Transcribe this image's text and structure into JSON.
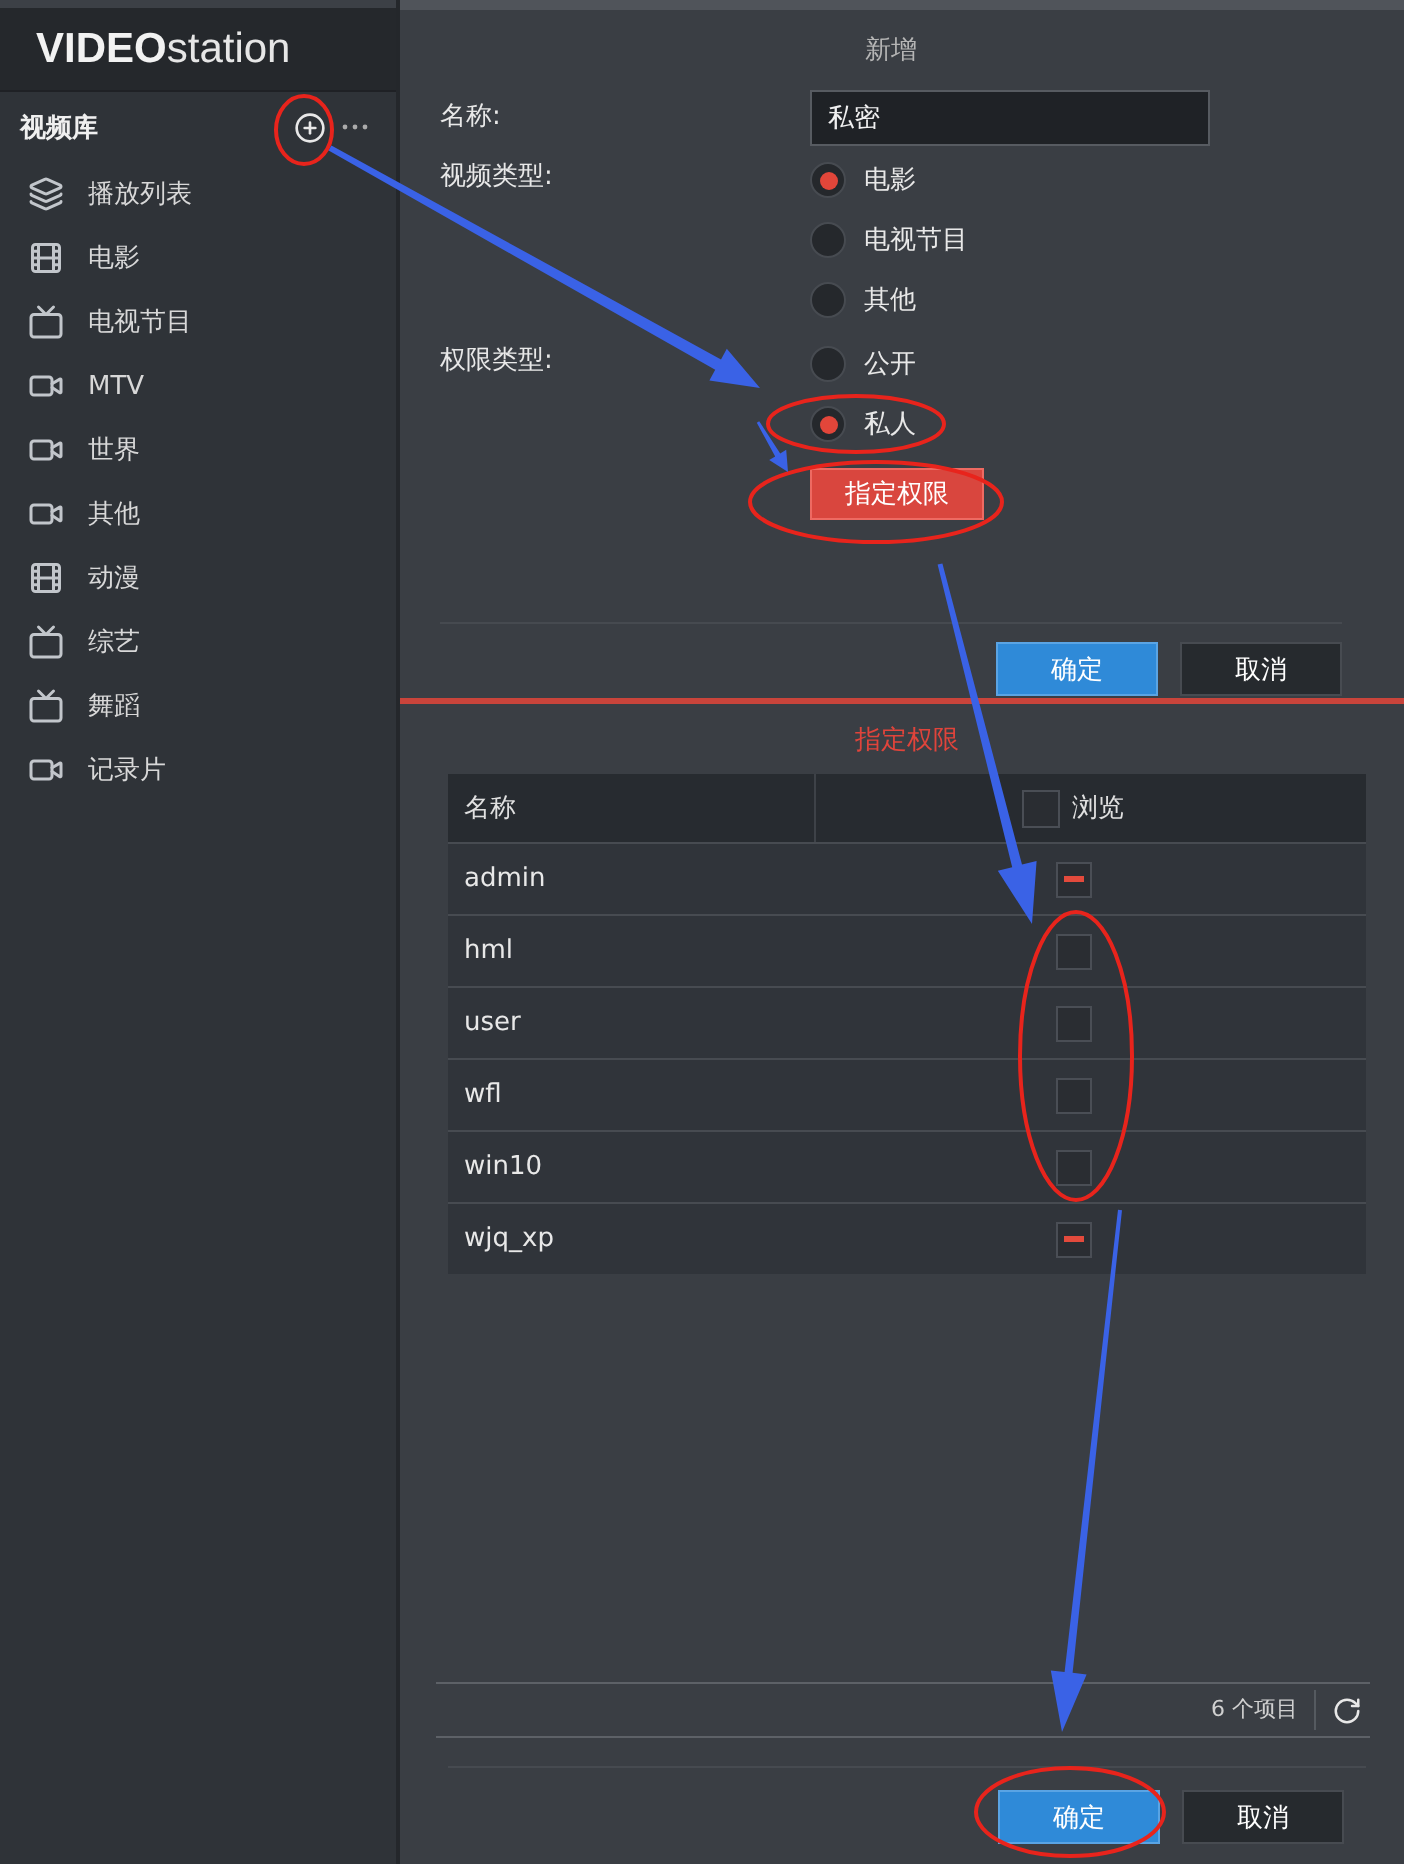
{
  "logo": {
    "brand": "VIDEO",
    "product": "station"
  },
  "sidebar": {
    "title": "视频库",
    "items": [
      {
        "label": "播放列表",
        "kind": "playlist",
        "selected": false
      },
      {
        "label": "电影",
        "kind": "movie",
        "selected": false
      },
      {
        "label": "电视节目",
        "kind": "tv",
        "selected": false
      },
      {
        "label": "MTV",
        "kind": "video",
        "selected": false
      },
      {
        "label": "世界",
        "kind": "video",
        "selected": false
      },
      {
        "label": "其他",
        "kind": "video",
        "selected": false
      },
      {
        "label": "动漫",
        "kind": "movie",
        "selected": false
      },
      {
        "label": "综艺",
        "kind": "tv",
        "selected": false
      },
      {
        "label": "舞蹈",
        "kind": "tv",
        "selected": false
      },
      {
        "label": "记录片",
        "kind": "video",
        "selected": false
      }
    ]
  },
  "add_dialog": {
    "title": "新增",
    "name_field": {
      "label": "名称:",
      "value": "私密"
    },
    "video_type": {
      "label": "视频类型:",
      "options": [
        {
          "label": "电影",
          "selected": true
        },
        {
          "label": "电视节目",
          "selected": false
        },
        {
          "label": "其他",
          "selected": false
        }
      ]
    },
    "permission_type": {
      "label": "权限类型:",
      "options": [
        {
          "label": "公开",
          "selected": false
        },
        {
          "label": "私人",
          "selected": true
        }
      ]
    },
    "assign_button": "指定权限",
    "buttons": [
      {
        "label": "确定",
        "kind": "primary"
      },
      {
        "label": "取消",
        "kind": "secondary"
      }
    ]
  },
  "permission_dialog": {
    "title": "指定权限",
    "columns": [
      {
        "label": "名称"
      },
      {
        "label": "浏览",
        "checked": false
      }
    ],
    "rows": [
      {
        "name": "admin",
        "checked": true
      },
      {
        "name": "hml",
        "checked": false
      },
      {
        "name": "user",
        "checked": false
      },
      {
        "name": "wfl",
        "checked": false
      },
      {
        "name": "win10",
        "checked": false
      },
      {
        "name": "wjq_xp",
        "checked": true
      }
    ],
    "count": "6 个项目",
    "buttons": [
      {
        "label": "确定",
        "kind": "primary"
      },
      {
        "label": "取消",
        "kind": "secondary"
      }
    ]
  }
}
